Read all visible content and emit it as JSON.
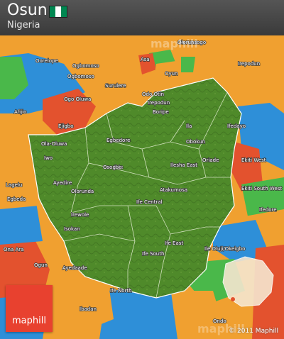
{
  "header": {
    "title": "Osun",
    "subtitle": "Nigeria",
    "flag_colors": [
      "#008751",
      "#ffffff",
      "#008751"
    ]
  },
  "colors": {
    "state": "#4f8a2a",
    "state_dark": "#3d6f1f",
    "neighbor_orange": "#f0a030",
    "neighbor_blue": "#2e8fd8",
    "neighbor_red": "#e3522e",
    "neighbor_green": "#4ab84a",
    "logo": "#e8412f"
  },
  "labels": [
    "Oorelope",
    "Olorunsogo",
    "Irepodun",
    "Ogbomoso",
    "Surulere",
    "Asa",
    "Oyun",
    "Ogo Oluwa",
    "Ejigbo",
    "Oriade",
    "Ede",
    "Egbedore",
    "Odo Otin",
    "Ifedayo",
    "Ife East",
    "Ife Central",
    "Ife South",
    "Ife North",
    "Ilesha East",
    "Atakumosa",
    "Obokun",
    "Ila",
    "Boripe",
    "Iwo",
    "Ayedire",
    "Olorunda",
    "Osogbo",
    "Irewole",
    "Isokan",
    "Ayedaade",
    "Egbeda",
    "Lagelu",
    "Ona Ara",
    "Ogun",
    "Ibadan",
    "Ekiti West",
    "Ekiti South West",
    "Ifedore",
    "Ile Oluji/Okeigbo",
    "Ondo",
    "Irepodun",
    "Ola-Oluwa",
    "Afijio",
    "Ogbomoso"
  ],
  "logo": {
    "text": "maphill"
  },
  "watermarks": [
    "maphill",
    "maphill"
  ],
  "copyright": "© 2011 Maphill"
}
